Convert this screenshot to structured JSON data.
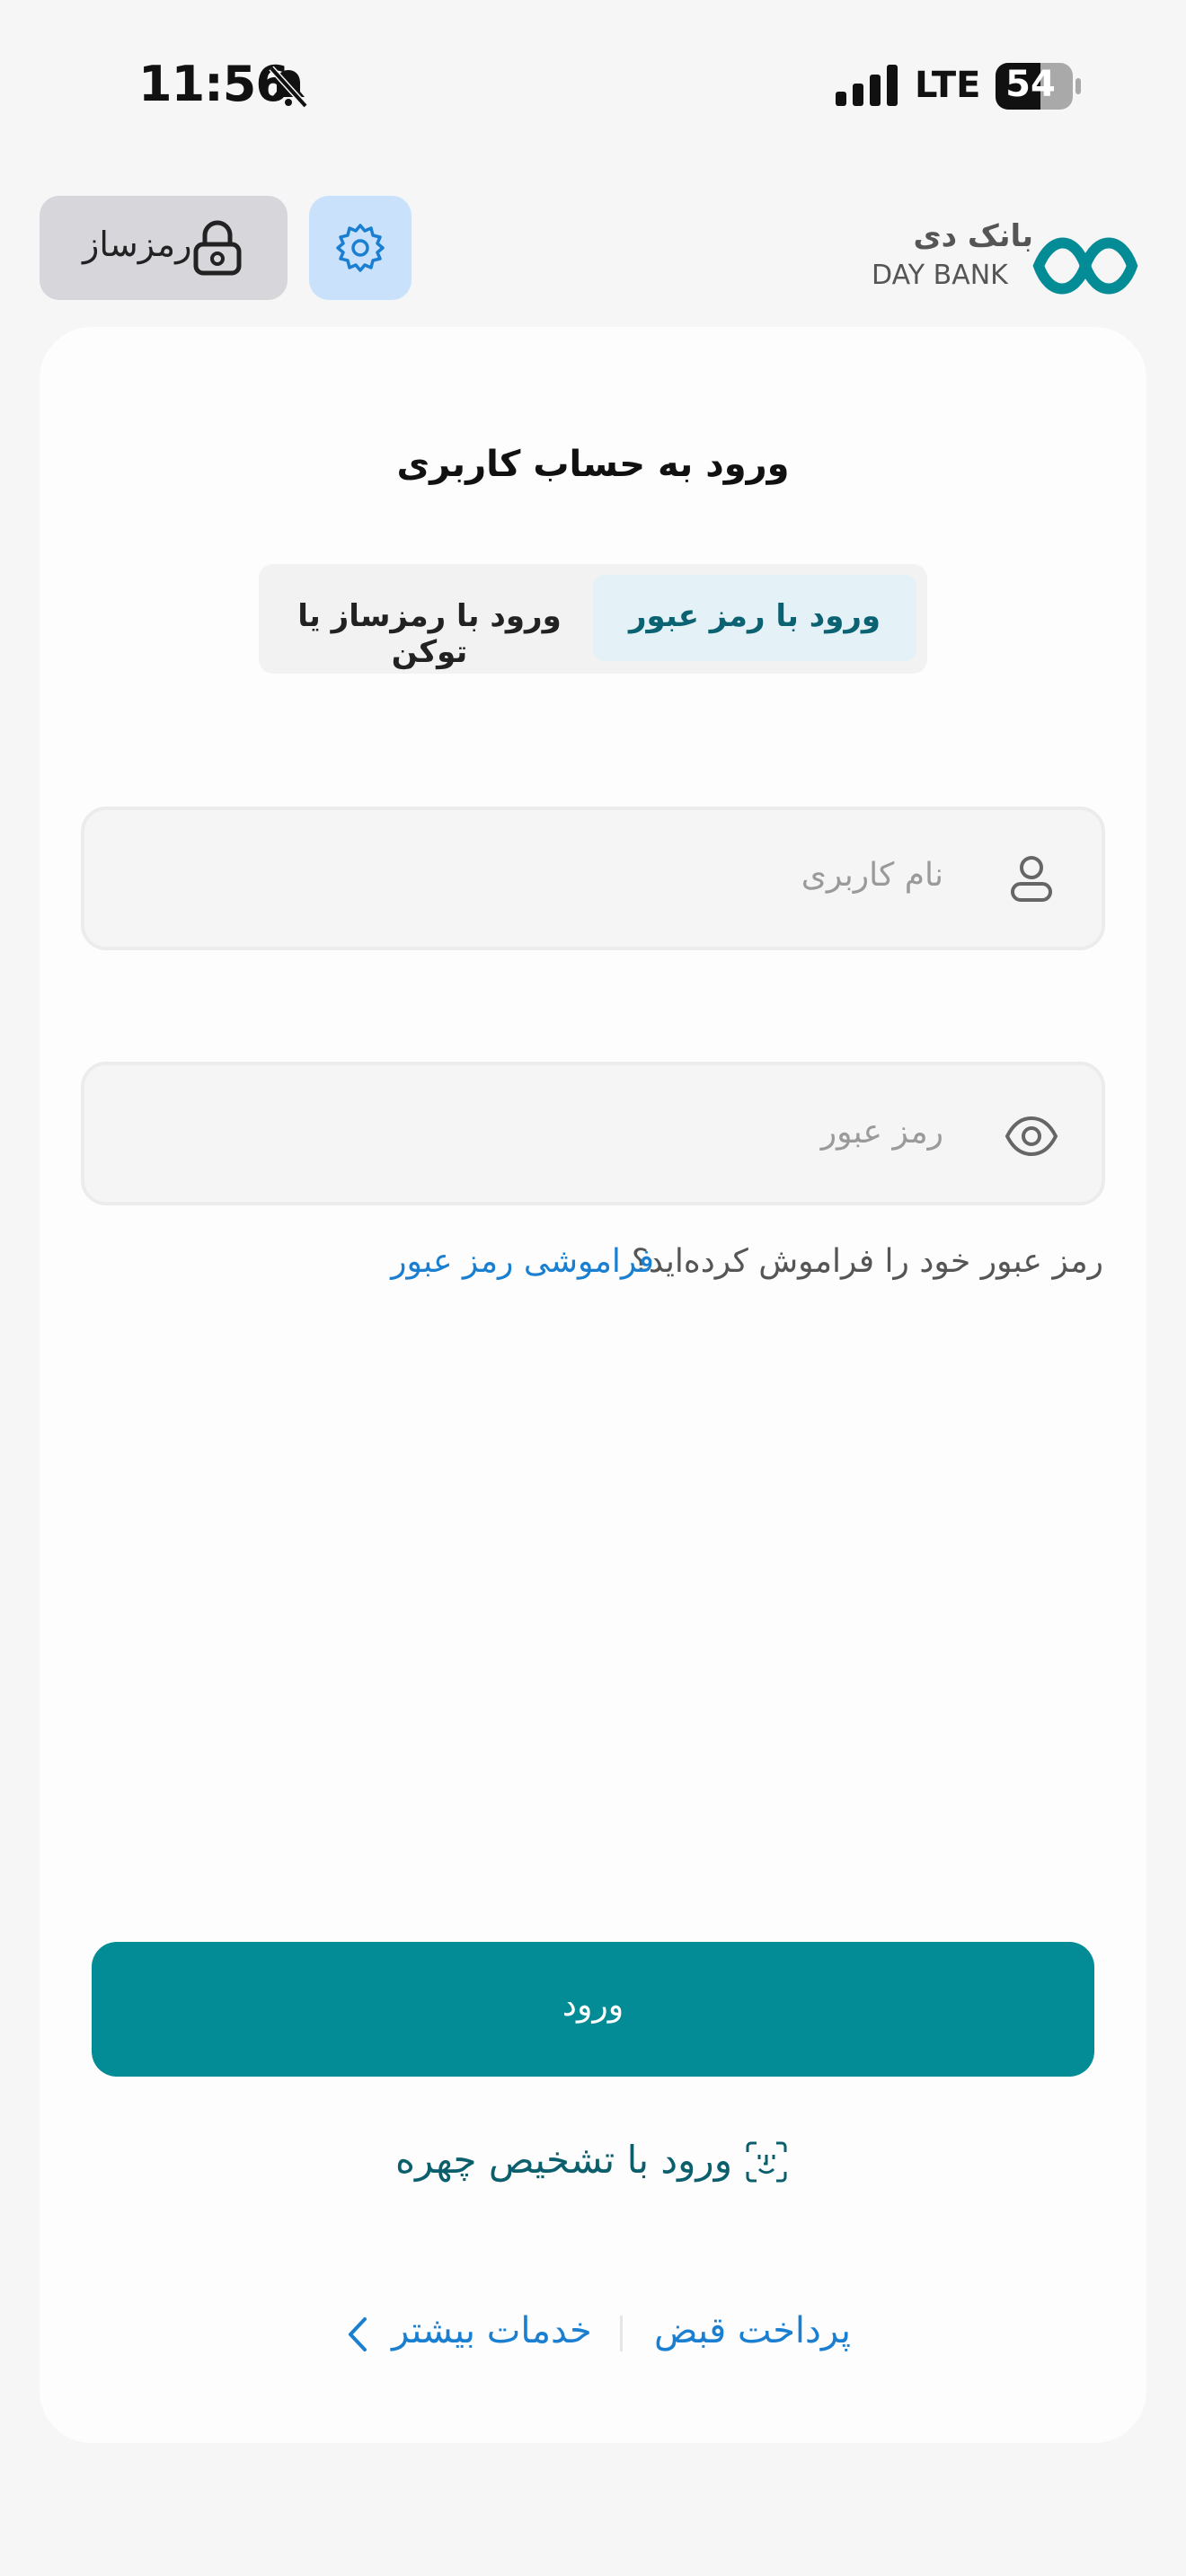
{
  "status_bar": {
    "time": "11:56",
    "network": "LTE",
    "battery": "54"
  },
  "header": {
    "token_button_label": "رمزساز",
    "logo_text_fa": "بانک دی",
    "logo_text_en": "DAY BANK"
  },
  "login": {
    "title": "ورود به حساب کاربری",
    "tabs": [
      {
        "label": "ورود با رمز عبور",
        "active": true
      },
      {
        "label": "ورود با رمزساز یا توکن",
        "active": false
      }
    ],
    "username_placeholder": "نام کاربری",
    "password_placeholder": "رمز عبور",
    "forgot_question": "رمز عبور خود را فراموش کرده‌اید؟",
    "forgot_link": "فراموشی رمز عبور",
    "submit_label": "ورود",
    "face_id_label": "ورود با تشخیص چهره"
  },
  "footer": {
    "pay_bill": "پرداخت قبض",
    "more_services": "خدمات بیشتر"
  },
  "colors": {
    "primary": "#038b96",
    "link": "#1a7fd1",
    "tab_active_bg": "#e4f1f6"
  }
}
